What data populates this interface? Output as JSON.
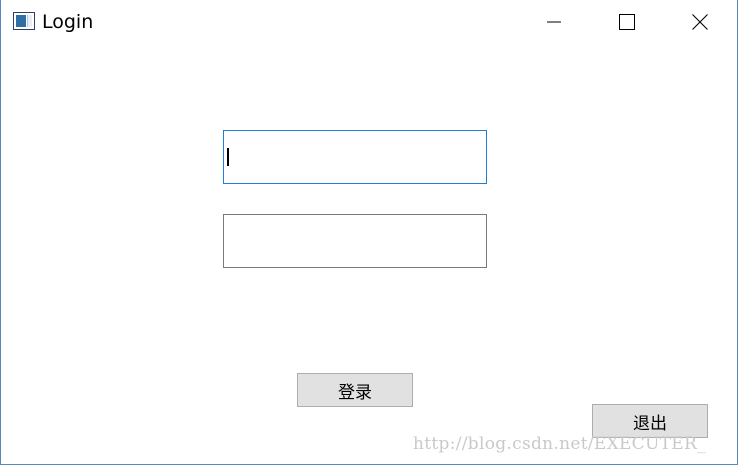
{
  "window": {
    "title": "Login",
    "controls": {
      "minimize_icon": "minimize-icon",
      "maximize_icon": "maximize-icon",
      "close_icon": "close-icon"
    }
  },
  "form": {
    "username": {
      "value": "",
      "placeholder": "",
      "focused": true
    },
    "password": {
      "value": "",
      "placeholder": ""
    }
  },
  "buttons": {
    "login_label": "登录",
    "exit_label": "退出"
  },
  "watermark": "http://blog.csdn.net/EXECUTER_",
  "colors": {
    "focus_border": "#1e7fd4",
    "field_border": "#7a7a7a",
    "button_bg": "#e1e1e1",
    "button_border": "#adadad",
    "window_border": "#5b86c5",
    "watermark": "#c9c9c9"
  }
}
